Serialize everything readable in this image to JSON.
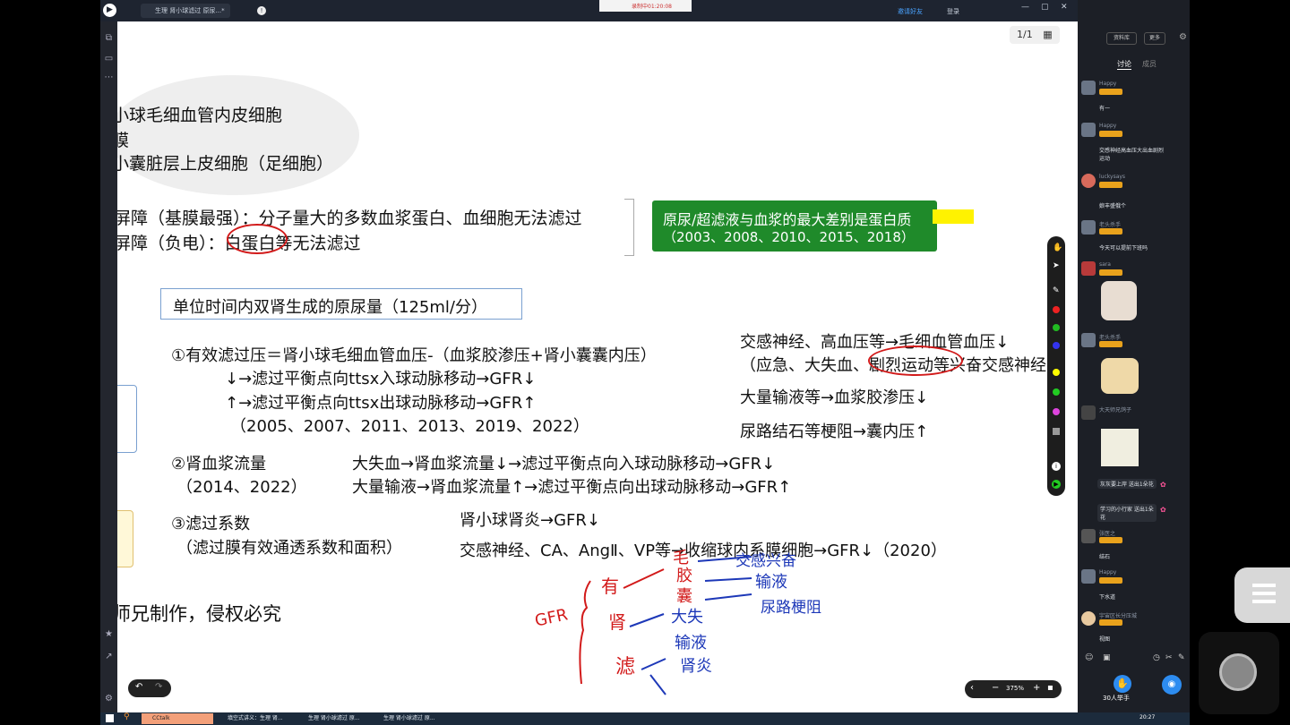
{
  "topbar": {
    "tab_title": "生理 肾小球滤过 原尿...*",
    "recording": "录制中01:20:08",
    "invite": "邀请好友",
    "login": "登录"
  },
  "board": {
    "page_indicator": "1/1",
    "lines": {
      "l1": "小球毛细血管内皮细胞",
      "l2": "膜",
      "l3": "小囊脏层上皮细胞（足细胞）",
      "l4": "屏障（基膜最强）：分子量大的多数血浆蛋白、血细胞无法滤过",
      "l5": "屏障（负电）：白蛋白等无法滤过",
      "green_line1": "原尿/超滤液与血浆的最大差别是蛋白质",
      "green_line2": "（2003、2008、2010、2015、2018）",
      "gfr_def": "单位时间内双肾生成的原尿量（125ml/分）",
      "f1": "①有效滤过压＝肾小球毛细血管血压-（血浆胶渗压+肾小囊囊内压）",
      "f2": "↓→滤过平衡点向ttsx入球动脉移动→GFR↓",
      "f3": "↑→滤过平衡点向ttsx出球动脉移动→GFR↑",
      "f4": "（2005、2007、2011、2013、2019、2022）",
      "r1": "交感神经、高血压等→毛细血管血压↓",
      "r2": "（应急、大失血、剧烈运动等兴奋交感神经",
      "r3": "大量输液等→血浆胶渗压↓",
      "r4": "尿路结石等梗阻→囊内压↑",
      "s1": "②肾血浆流量",
      "s2": "（2014、2022）",
      "s3": "大失血→肾血浆流量↓→滤过平衡点向入球动脉移动→GFR↓",
      "s4": "大量输液→肾血浆流量↑→滤过平衡点向出球动脉移动→GFR↑",
      "k1": "③滤过系数",
      "k2": "（滤过膜有效通透系数和面积）",
      "k3": "肾小球肾炎→GFR↓",
      "k4": "交感神经、CA、AngⅡ、VP等→收缩球内系膜细胞→GFR↓（2020）",
      "copyright": "师兄制作，侵权必究"
    },
    "handwriting": {
      "gfr": "GFR",
      "you": "有",
      "shen": "肾",
      "lv": "滤",
      "mao": "毛",
      "jiao": "胶",
      "nang": "囊",
      "dashi": "大失",
      "shuye": "输液",
      "shenyan": "肾炎",
      "shuye2": "输液",
      "niaolu": "尿路梗阻",
      "jiaogan": "交感兴奋"
    },
    "zoom": "375%"
  },
  "chat": {
    "tabs": [
      "讨论",
      "成员"
    ],
    "buttons": [
      "资料库",
      "更多"
    ],
    "messages": [
      {
        "user": "Happy",
        "text": "有一"
      },
      {
        "user": "Happy",
        "text": "交感神经高血压大出血剧烈运动"
      },
      {
        "user": "luckysays",
        "text": ""
      },
      {
        "user": "",
        "text": "娘丰盛俄个"
      },
      {
        "user": "老头杀手",
        "text": "今天可以提前下班吗"
      },
      {
        "user": "sara",
        "text": ""
      },
      {
        "user": "老头杀手",
        "text": ""
      },
      {
        "user": "大天师兄鸽子",
        "text": ""
      },
      {
        "user": "",
        "text": "灰灰要上岸 送出1朵花"
      },
      {
        "user": "",
        "text": "学习的小行家 送出1朵花"
      },
      {
        "user": "张医之",
        "text": "结石"
      },
      {
        "user": "Happy",
        "text": "下水道"
      },
      {
        "user": "宇宙区长分压城",
        "text": "视图"
      }
    ],
    "raise_hand": "30人举手"
  },
  "taskbar": {
    "items": [
      "CCtalk",
      "填空式讲义：生理 肾...",
      "生理 肾小球滤过 原...",
      "生理 肾小球滤过 原..."
    ],
    "clock": "20:27"
  },
  "colors": {
    "highlight": "#fff200",
    "green_box": "#1f8a2a",
    "ink_red": "#d21a1a",
    "ink_blue": "#1d38b8"
  }
}
